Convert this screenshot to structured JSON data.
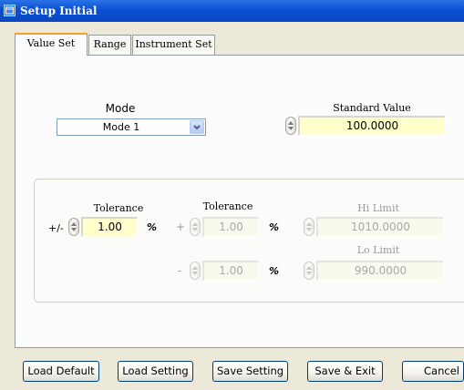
{
  "window": {
    "title": "Setup Initial"
  },
  "tabs": [
    {
      "label": "Value Set",
      "active": true
    },
    {
      "label": "Range",
      "active": false
    },
    {
      "label": "Instrument Set",
      "active": false
    }
  ],
  "mode": {
    "label": "Mode",
    "selected": "Mode 1"
  },
  "standard_value": {
    "label": "Standard Value",
    "value": "100.0000"
  },
  "tolerance_group": {
    "tol_sym_label": "Tolerance",
    "tol_sym_prefix": "+/-",
    "tol_sym_value": "1.00",
    "tol_sym_unit": "%",
    "tol_asym_label": "Tolerance",
    "tol_plus_prefix": "+",
    "tol_plus_value": "1.00",
    "tol_plus_unit": "%",
    "tol_minus_prefix": "-",
    "tol_minus_value": "1.00",
    "tol_minus_unit": "%",
    "hi_limit_label": "Hi Limit",
    "hi_limit_value": "1010.0000",
    "lo_limit_label": "Lo Limit",
    "lo_limit_value": "990.0000"
  },
  "buttons": {
    "load_default": "Load Default",
    "load_setting": "Load Setting",
    "save_setting": "Save Setting",
    "save_exit": "Save & Exit",
    "cancel": "Cancel"
  },
  "colors": {
    "titlebar": "#0a4fd0",
    "field_bg": "#ffffcc",
    "active_tab_accent": "#f0a030"
  }
}
